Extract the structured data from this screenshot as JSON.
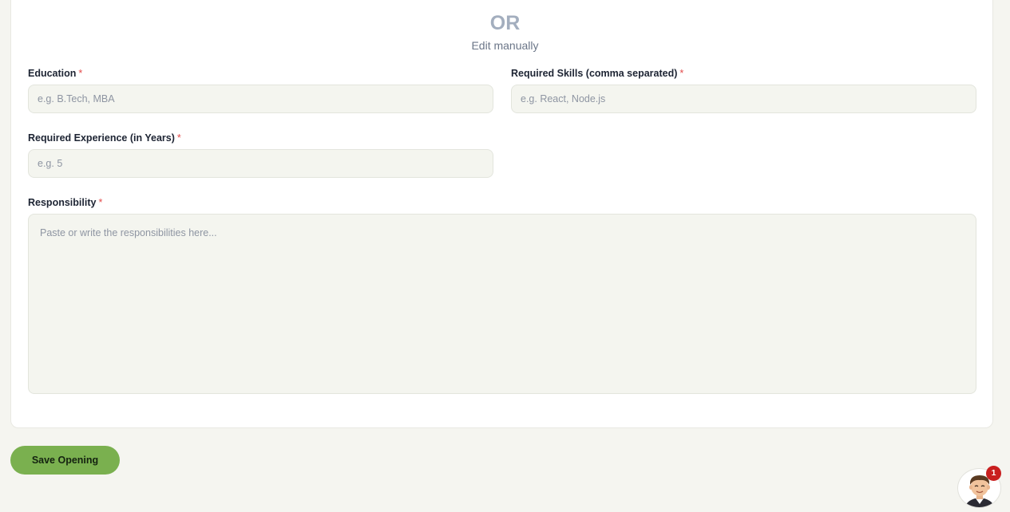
{
  "divider": {
    "or_text": "OR",
    "subtitle": "Edit manually"
  },
  "form": {
    "required_marker": "*",
    "education": {
      "label": "Education",
      "placeholder": "e.g. B.Tech, MBA",
      "value": ""
    },
    "skills": {
      "label": "Required Skills (comma separated)",
      "placeholder": "e.g. React, Node.js",
      "value": ""
    },
    "experience": {
      "label": "Required Experience (in Years)",
      "placeholder": "e.g. 5",
      "value": ""
    },
    "responsibility": {
      "label": "Responsibility",
      "placeholder": "Paste or write the responsibilities here...",
      "value": ""
    }
  },
  "actions": {
    "save_label": "Save Opening"
  },
  "assistant": {
    "icon": "assistant-avatar-icon",
    "notification_count": "1"
  },
  "colors": {
    "accent": "#7ab04f",
    "badge": "#c91f1f",
    "required": "#e34b4b",
    "page_background": "#f5f5f0"
  }
}
